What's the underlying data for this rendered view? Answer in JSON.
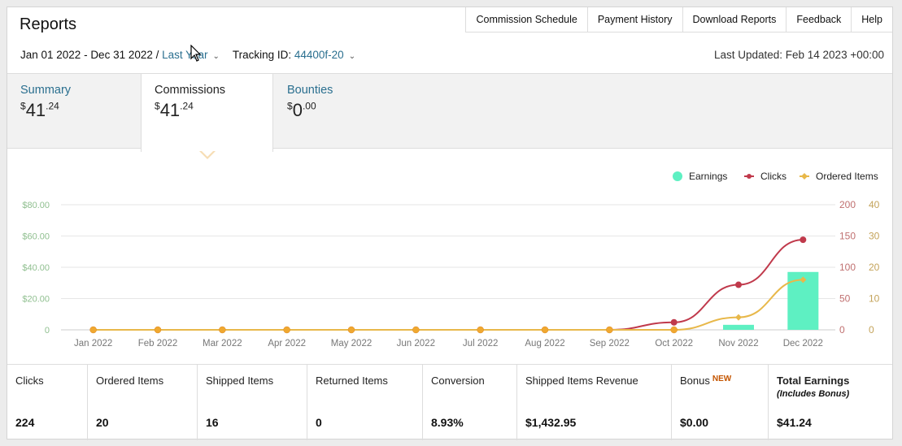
{
  "header": {
    "title": "Reports",
    "nav": [
      "Commission Schedule",
      "Payment History",
      "Download Reports",
      "Feedback",
      "Help"
    ]
  },
  "filters": {
    "date_range": "Jan 01 2022 - Dec 31 2022 /",
    "period": "Last Year",
    "tracking_label": "Tracking ID:",
    "tracking_id": "44400f-20",
    "last_updated": "Last Updated: Feb 14 2023 +00:00"
  },
  "tabs": [
    {
      "label": "Summary",
      "currency": "$",
      "whole": "41",
      "cents": ".24"
    },
    {
      "label": "Commissions",
      "currency": "$",
      "whole": "41",
      "cents": ".24",
      "active": true
    },
    {
      "label": "Bounties",
      "currency": "$",
      "whole": "0",
      "cents": ".00"
    }
  ],
  "chart_data": {
    "type": "bar+line",
    "categories": [
      "Jan 2022",
      "Feb 2022",
      "Mar 2022",
      "Apr 2022",
      "May 2022",
      "Jun 2022",
      "Jul 2022",
      "Aug 2022",
      "Sep 2022",
      "Oct 2022",
      "Nov 2022",
      "Dec 2022"
    ],
    "legend": [
      "Earnings",
      "Clicks",
      "Ordered Items"
    ],
    "series": [
      {
        "name": "Earnings",
        "type": "bar",
        "axis": "left",
        "color": "#5ef0c2",
        "values": [
          0,
          0,
          0,
          0,
          0,
          0,
          0,
          0,
          0,
          0,
          3.2,
          37
        ]
      },
      {
        "name": "Clicks",
        "type": "line",
        "axis": "right1",
        "color": "#c0394b",
        "values": [
          0,
          0,
          0,
          0,
          0,
          0,
          0,
          0,
          0,
          12,
          72,
          144
        ]
      },
      {
        "name": "Ordered Items",
        "type": "line",
        "axis": "right2",
        "color": "#e8b84a",
        "values": [
          0,
          0,
          0,
          0,
          0,
          0,
          0,
          0,
          0,
          0,
          4,
          16
        ]
      }
    ],
    "left_axis": {
      "ticks": [
        "$80.00",
        "$60.00",
        "$40.00",
        "$20.00",
        "0"
      ],
      "range": [
        0,
        80
      ],
      "color": "#8fbf8f"
    },
    "right_axis_1": {
      "ticks": [
        "200",
        "150",
        "100",
        "50",
        "0"
      ],
      "range": [
        0,
        200
      ],
      "color": "#c07070"
    },
    "right_axis_2": {
      "ticks": [
        "40",
        "30",
        "20",
        "10",
        "0"
      ],
      "range": [
        0,
        40
      ],
      "color": "#c4a35a"
    }
  },
  "stats": [
    {
      "label": "Clicks",
      "value": "224"
    },
    {
      "label": "Ordered Items",
      "value": "20"
    },
    {
      "label": "Shipped Items",
      "value": "16"
    },
    {
      "label": "Returned Items",
      "value": "0"
    },
    {
      "label": "Conversion",
      "value": "8.93%"
    },
    {
      "label": "Shipped Items Revenue",
      "value": "$1,432.95"
    },
    {
      "label": "Bonus",
      "badge": "NEW",
      "value": "$0.00"
    },
    {
      "label": "Total Earnings",
      "sub": "(Includes Bonus)",
      "value": "$41.24"
    }
  ],
  "colors": {
    "link": "#2a6f8f",
    "earnings": "#5ef0c2",
    "clicks": "#c0394b",
    "ordered": "#e8b84a"
  }
}
